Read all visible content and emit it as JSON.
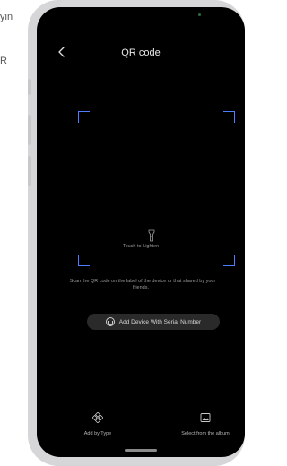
{
  "background": {
    "text_line_1": "yin",
    "text_line_2": "R"
  },
  "header": {
    "title": "QR code",
    "back_icon": "chevron-left-icon"
  },
  "scanner": {
    "frame_color": "#4f7dff",
    "flashlight_label": "Touch to Lighten",
    "flashlight_icon": "flashlight-icon",
    "hint_line_1": "Scan the QR code on the label of the device or that shared by your",
    "hint_line_2": "friends."
  },
  "serial_button": {
    "label": "Add Device With Serial Number",
    "icon": "serial-number-icon"
  },
  "bottom_bar": {
    "left_label": "Add by Type",
    "left_icon": "device-type-icon",
    "right_label": "Select from the album",
    "right_icon": "album-icon"
  }
}
